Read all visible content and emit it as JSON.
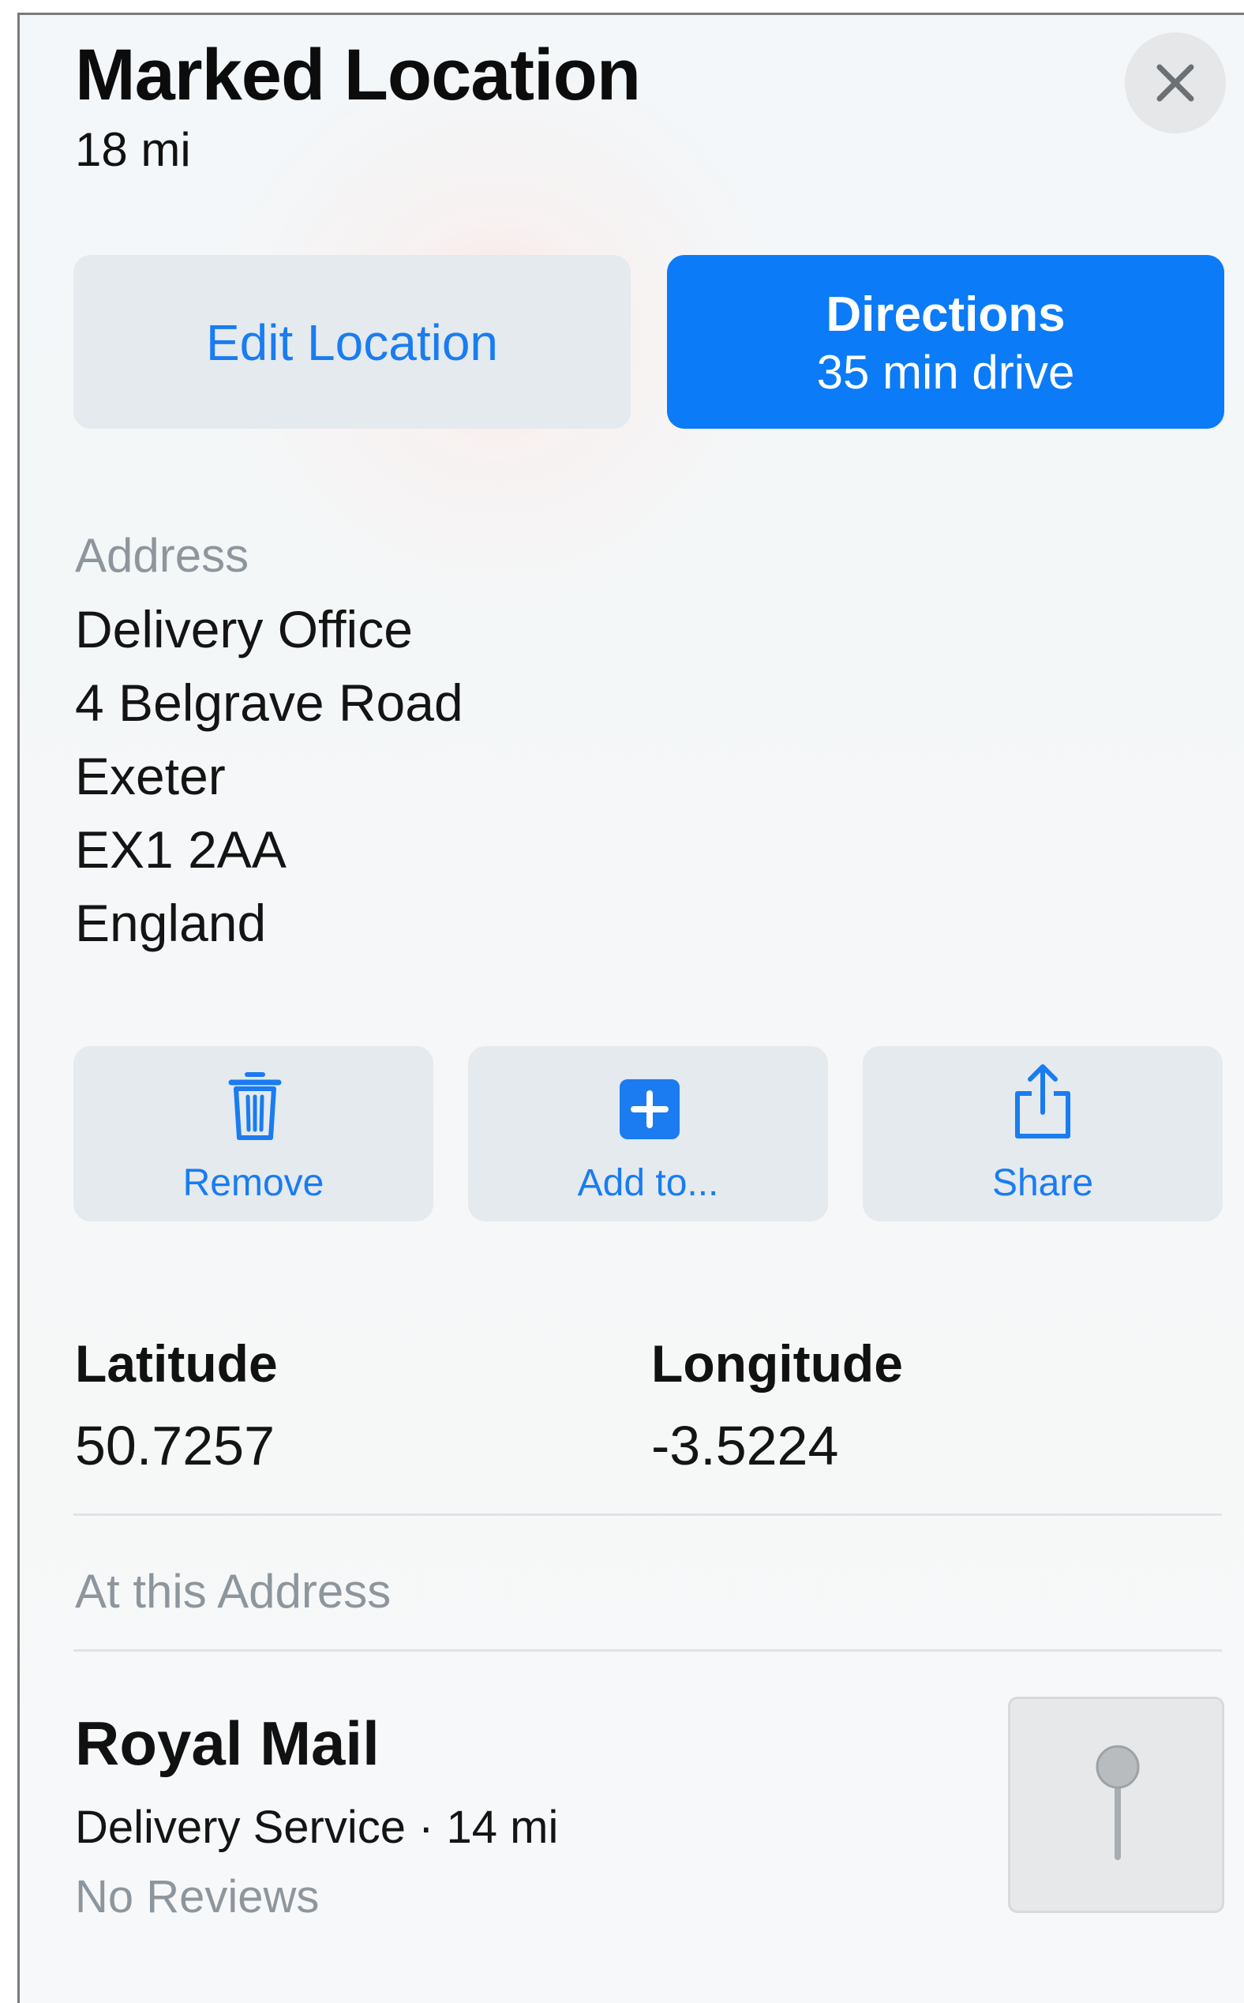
{
  "header": {
    "title": "Marked Location",
    "distance": "18 mi",
    "close_icon": "close-icon"
  },
  "primary_actions": {
    "edit_label": "Edit Location",
    "directions_label": "Directions",
    "directions_sub": "35 min drive"
  },
  "address": {
    "label": "Address",
    "lines": [
      "Delivery Office",
      "4 Belgrave Road",
      "Exeter",
      "EX1 2AA",
      "England"
    ]
  },
  "actions": [
    {
      "label": "Remove",
      "icon": "trash-icon"
    },
    {
      "label": "Add to...",
      "icon": "plus-square-icon"
    },
    {
      "label": "Share",
      "icon": "share-icon"
    }
  ],
  "coordinates": {
    "latitude_label": "Latitude",
    "latitude_value": "50.7257",
    "longitude_label": "Longitude",
    "longitude_value": "-3.5224"
  },
  "at_address": {
    "label": "At this Address",
    "name": "Royal Mail",
    "subtitle": "Delivery Service · 14 mi",
    "reviews": "No Reviews",
    "thumb_icon": "map-pin-icon"
  },
  "colors": {
    "accent": "#0b7bf7",
    "link": "#1a7cf0",
    "secondary_text": "#8e969d",
    "button_bg": "#e4eaee"
  }
}
